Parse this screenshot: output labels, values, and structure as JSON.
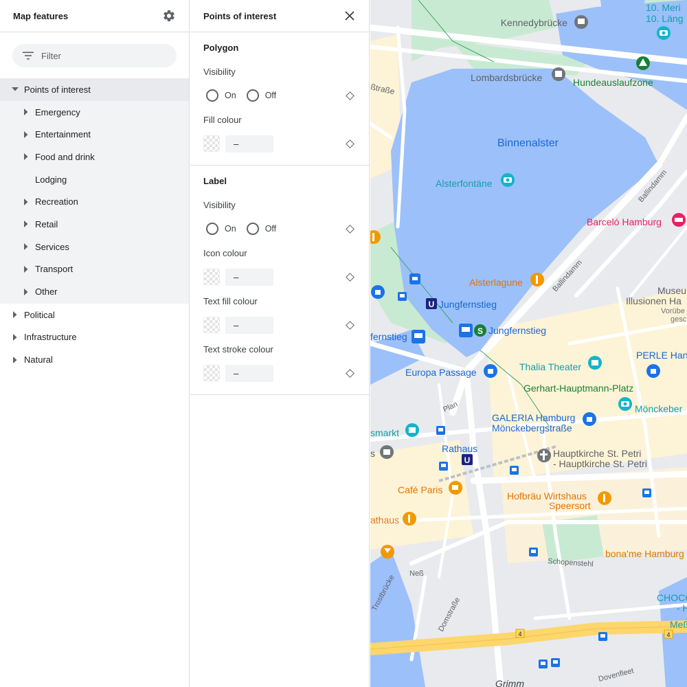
{
  "left_panel": {
    "title": "Map features",
    "settings_icon": "gear-icon",
    "filter_placeholder": "Filter",
    "tree": [
      {
        "label": "Points of interest",
        "expanded": true,
        "children": [
          {
            "label": "Emergency",
            "has_children": true
          },
          {
            "label": "Entertainment",
            "has_children": true
          },
          {
            "label": "Food and drink",
            "has_children": true
          },
          {
            "label": "Lodging",
            "has_children": false
          },
          {
            "label": "Recreation",
            "has_children": true
          },
          {
            "label": "Retail",
            "has_children": true
          },
          {
            "label": "Services",
            "has_children": true
          },
          {
            "label": "Transport",
            "has_children": true
          },
          {
            "label": "Other",
            "has_children": true
          }
        ]
      },
      {
        "label": "Political",
        "expanded": false
      },
      {
        "label": "Infrastructure",
        "expanded": false
      },
      {
        "label": "Natural",
        "expanded": false
      }
    ]
  },
  "middle_panel": {
    "title": "Points of interest",
    "close_icon": "close-icon",
    "polygon": {
      "title": "Polygon",
      "visibility_label": "Visibility",
      "on_label": "On",
      "off_label": "Off",
      "fill_label": "Fill colour",
      "fill_value": "–"
    },
    "label": {
      "title": "Label",
      "visibility_label": "Visibility",
      "on_label": "On",
      "off_label": "Off",
      "icon_label": "Icon colour",
      "icon_value": "–",
      "text_fill_label": "Text fill colour",
      "text_fill_value": "–",
      "text_stroke_label": "Text stroke colour",
      "text_stroke_value": "–"
    }
  },
  "map": {
    "labels": {
      "kennedy": "Kennedybrücke",
      "merian1": "10. Meri",
      "merian2": "10. Läng",
      "lombards": "Lombardsbrücke",
      "hundeauslauf": "Hundeauslaufzone",
      "strasse": "ßtraße",
      "binnenalster": "Binnenalster",
      "alsterfontaene": "Alsterfontäne",
      "ballindamm1": "Ballindamm",
      "ballindamm2": "Ballindamm",
      "barcelo": "Barceló Hamburg",
      "alsterlagune": "Alsterlagune",
      "museum1": "Museu",
      "museum2": "Illusionen Ha",
      "museum3": "Vorübe",
      "museum4": "gesc",
      "jungfernstieg_u": "Jungfernstieg",
      "jungfernstieg_s": "Jungfernstieg",
      "jungfernstieg_left": "fernstieg",
      "thalia": "Thalia Theater",
      "perle": "PERLE Han",
      "europa": "Europa Passage",
      "gerhart": "Gerhart-Hauptmann-Platz",
      "moenckeb": "Mönckeber",
      "plan": "Plan",
      "galeria1": "GALERIA Hamburg",
      "galeria2": "Mönckebergstraße",
      "smarkt": "smarkt",
      "rathaus": "Rathaus",
      "petri1": "Hauptkirche St. Petri",
      "petri2": "- Hauptkirche St. Petri",
      "s_left": "s",
      "cafe": "Café Paris",
      "hofbraeu1": "Hofbräu Wirtshaus",
      "hofbraeu2": "Speersort",
      "athaus": "athaus",
      "bona": "bona'me Hamburg",
      "schopen": "Schopenstehl",
      "ness": "Neß",
      "trost": "Trostbrücke",
      "domstrasse": "Domstraße",
      "choco1": "CHOCO",
      "choco2": "- Ha",
      "messe": "Meß",
      "road4a": "4",
      "road4b": "4",
      "dovenfleet": "Dovenfleet",
      "grimm": "Grimm"
    },
    "colors": {
      "water": "#9cc0f9",
      "park": "#c9ead2",
      "road": "#ffffff",
      "highway": "#fdd66c",
      "commercial": "#fdf3d6",
      "land": "#e8eaed",
      "poi_blue": "#1a73e8",
      "poi_teal": "#12b5cb",
      "poi_orange": "#f29900",
      "poi_green": "#188038",
      "poi_gray": "#70757a",
      "poi_pink": "#e91e63",
      "label_blue": "#1967d2",
      "label_teal": "#129eaf",
      "label_orange": "#e37400"
    }
  }
}
